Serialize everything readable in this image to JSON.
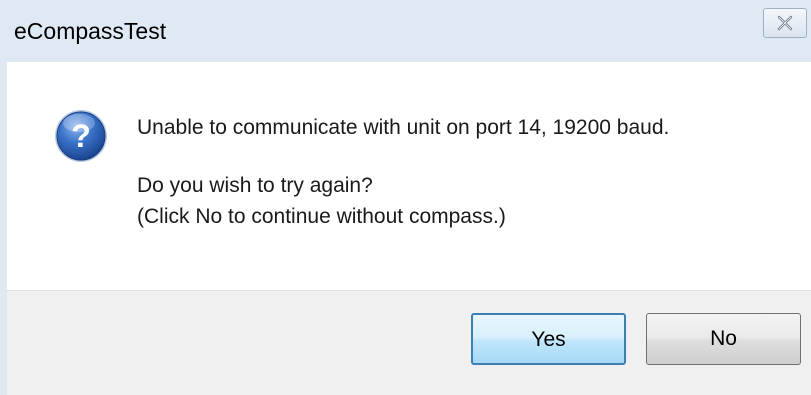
{
  "window": {
    "title": "eCompassTest",
    "close_icon": "close-icon"
  },
  "message": {
    "icon": "question-icon",
    "line1": "Unable to communicate with unit on port 14, 19200 baud.",
    "line2": "Do you wish to try again?",
    "line3": "(Click No to continue without compass.)"
  },
  "buttons": {
    "yes_label": "Yes",
    "no_label": "No"
  },
  "colors": {
    "titlebar": "#dfe9f4",
    "footer": "#f0f0f0",
    "default_button_border": "#3c7fb1",
    "icon_blue": "#2a5fb0"
  }
}
